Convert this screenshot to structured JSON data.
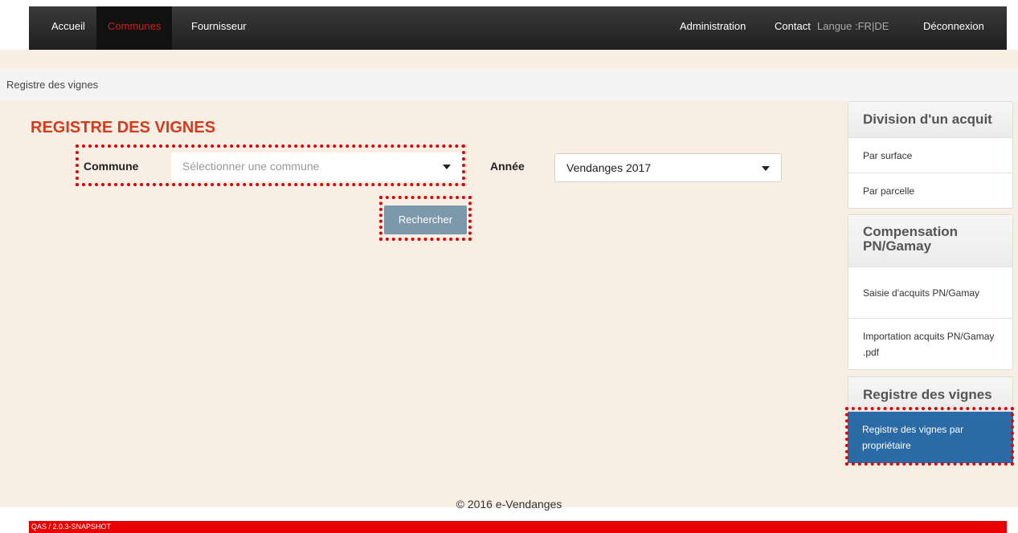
{
  "nav": {
    "left": [
      {
        "label": "Accueil"
      },
      {
        "label": "Communes"
      },
      {
        "label": "Fournisseur"
      }
    ],
    "right": {
      "administration": "Administration",
      "contact": "Contact",
      "langue_label": "Langue :",
      "lang_fr": "FR",
      "lang_sep": "|",
      "lang_de": "DE",
      "logout": "Déconnexion"
    }
  },
  "breadcrumb": "Registre des vignes",
  "page_title": "REGISTRE DES VIGNES",
  "form": {
    "commune_label": "Commune",
    "commune_placeholder": "Sélectionner une commune",
    "annee_label": "Année",
    "annee_value": "Vendanges 2017",
    "search_button": "Rechercher"
  },
  "sidebar": {
    "division": {
      "title": "Division d'un acquit",
      "items": [
        "Par surface",
        "Par parcelle"
      ]
    },
    "compensation": {
      "title": "Compensation PN/Gamay",
      "items": [
        "Saisie d'acquits PN/Gamay",
        "Importation acquits PN/Gamay .pdf"
      ]
    },
    "registre": {
      "title": "Registre des vignes",
      "items": [
        "Registre des vignes par propriétaire"
      ]
    }
  },
  "footer": {
    "copyright": "© 2016 e-Vendanges",
    "version": "QAS / 2.0.3-SNAPSHOT"
  },
  "colors": {
    "accent_red": "#d43a1c",
    "active_blue": "#2a6aa6",
    "button": "#7d97ab",
    "highlight_dotted": "#e00000"
  }
}
